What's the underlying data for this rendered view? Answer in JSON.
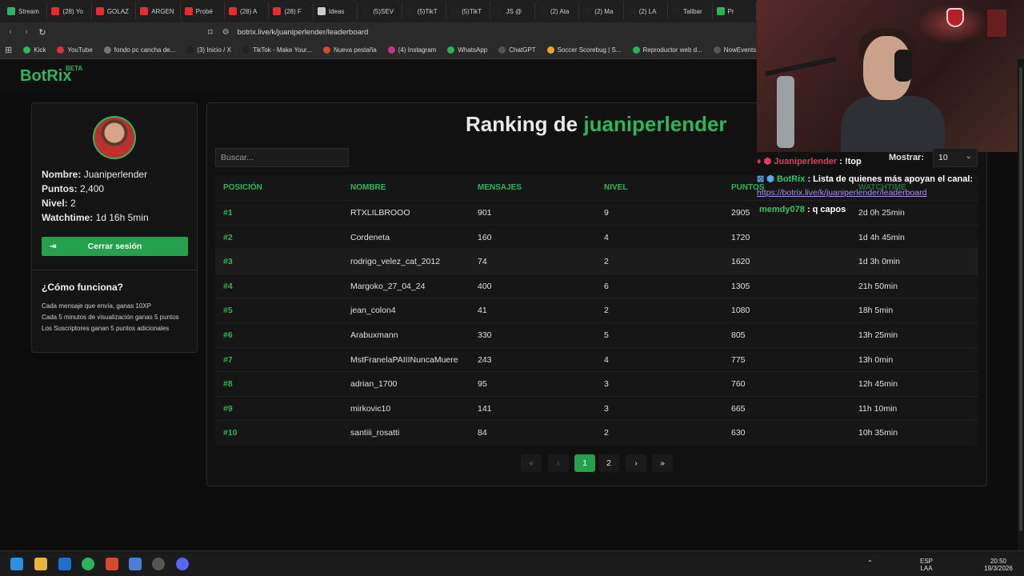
{
  "browser": {
    "tabs": [
      "Stream",
      "(28) Yo",
      "GOLAZ",
      "ARGEN",
      "Probé",
      "(28) A",
      "(28) F",
      "Ideas",
      "(5)SEV",
      "(5)TikT",
      "(5)TikT",
      "JS @",
      "(2) Ata",
      "(2) Ma",
      "(2) LA",
      "Talibar",
      "Pr"
    ],
    "url": "botrix.live/k/juaniperlender/leaderboard",
    "bookmarks": [
      "Kick",
      "YouTube",
      "fondo pc cancha de...",
      "(3) Inicio / X",
      "TikTok - Make Your...",
      "Nueva pestaña",
      "(4) Instagram",
      "WhatsApp",
      "ChatGPT",
      "Soccer Scorebug | S...",
      "Reproductor web d...",
      "NowEvents - C"
    ]
  },
  "brand": {
    "logo": "BotRix",
    "beta": "BETA"
  },
  "profile": {
    "nombre_label": "Nombre:",
    "nombre": "Juaniperlender",
    "puntos_label": "Puntos:",
    "puntos": "2,400",
    "nivel_label": "Nivel:",
    "nivel": "2",
    "watchtime_label": "Watchtime:",
    "watchtime": "1d 16h 5min",
    "logout": "Cerrar sesión"
  },
  "how": {
    "title": "¿Cómo funciona?",
    "lines": [
      "Cada mensaje que envía, ganas 10XP",
      "Cada 5 minutos de visualización ganas 5 puntos",
      "Los Suscriptores ganan 5 puntos adicionales"
    ]
  },
  "ranking": {
    "title_prefix": "Ranking de",
    "title_user": "juaniperlender",
    "search_placeholder": "Buscar...",
    "mostrar_label": "Mostrar:",
    "mostrar_value": "10",
    "columns": [
      "POSICIÓN",
      "NOMBRE",
      "MENSAJES",
      "NIVEL",
      "PUNTOS",
      "WATCHTIME"
    ],
    "rows": [
      {
        "pos": "#1",
        "nombre": "RTXLILBROOO",
        "mensajes": "901",
        "nivel": "9",
        "puntos": "2905",
        "watchtime": "2d 0h 25min"
      },
      {
        "pos": "#2",
        "nombre": "Cordeneta",
        "mensajes": "160",
        "nivel": "4",
        "puntos": "1720",
        "watchtime": "1d 4h 45min"
      },
      {
        "pos": "#3",
        "nombre": "rodrigo_velez_cat_2012",
        "mensajes": "74",
        "nivel": "2",
        "puntos": "1620",
        "watchtime": "1d 3h 0min"
      },
      {
        "pos": "#4",
        "nombre": "Margoko_27_04_24",
        "mensajes": "400",
        "nivel": "6",
        "puntos": "1305",
        "watchtime": "21h 50min"
      },
      {
        "pos": "#5",
        "nombre": "jean_colon4",
        "mensajes": "41",
        "nivel": "2",
        "puntos": "1080",
        "watchtime": "18h 5min"
      },
      {
        "pos": "#6",
        "nombre": "Arabuxmann",
        "mensajes": "330",
        "nivel": "5",
        "puntos": "805",
        "watchtime": "13h 25min"
      },
      {
        "pos": "#7",
        "nombre": "MstFranelaPAIIINuncaMuere",
        "mensajes": "243",
        "nivel": "4",
        "puntos": "775",
        "watchtime": "13h 0min"
      },
      {
        "pos": "#8",
        "nombre": "adrian_1700",
        "mensajes": "95",
        "nivel": "3",
        "puntos": "760",
        "watchtime": "12h 45min"
      },
      {
        "pos": "#9",
        "nombre": "mirkovic10",
        "mensajes": "141",
        "nivel": "3",
        "puntos": "665",
        "watchtime": "11h 10min"
      },
      {
        "pos": "#10",
        "nombre": "santiii_rosatti",
        "mensajes": "84",
        "nivel": "2",
        "puntos": "630",
        "watchtime": "10h 35min"
      }
    ],
    "pages": [
      "«",
      "‹",
      "1",
      "2",
      "›",
      "»"
    ],
    "current_page": "1"
  },
  "chat": [
    {
      "user": "Juaniperlender",
      "msg": ": !top"
    },
    {
      "user": "BotRix",
      "msg": ": Lista de quienes más apoyan el canal:",
      "link": "https://botrix.live/k/juaniperlender/leaderboard"
    },
    {
      "user": "memdy078",
      "msg": ": q capos"
    }
  ],
  "taskbar": {
    "lang": "ESP",
    "lang2": "LAA",
    "time": "20:50",
    "date": "19/3/2026"
  },
  "colors": {
    "accent": "#2fb55b",
    "background": "#0d0d0d"
  }
}
